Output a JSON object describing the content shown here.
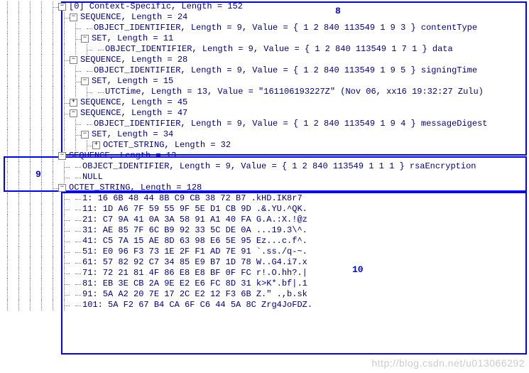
{
  "rows": [
    {
      "indent": 5,
      "expander": "−",
      "text": "[0] Context-Specific, Length = 152"
    },
    {
      "indent": 6,
      "expander": "−",
      "text": "SEQUENCE, Length = 24"
    },
    {
      "indent": 7,
      "expander": "",
      "text": "OBJECT_IDENTIFIER, Length = 9, Value = { 1 2 840 113549 1 9 3 } contentType"
    },
    {
      "indent": 7,
      "expander": "−",
      "text": "SET, Length = 11"
    },
    {
      "indent": 8,
      "expander": "",
      "text": "OBJECT_IDENTIFIER, Length = 9, Value = { 1 2 840 113549 1 7 1 } data"
    },
    {
      "indent": 6,
      "expander": "−",
      "text": "SEQUENCE, Length = 28"
    },
    {
      "indent": 7,
      "expander": "",
      "text": "OBJECT_IDENTIFIER, Length = 9, Value = { 1 2 840 113549 1 9 5 } signingTime"
    },
    {
      "indent": 7,
      "expander": "−",
      "text": "SET, Length = 15"
    },
    {
      "indent": 8,
      "expander": "",
      "text": "UTCTime, Length = 13, Value = \"161106193227Z\" (Nov 06, xx16 19:32:27 Zulu)"
    },
    {
      "indent": 6,
      "expander": "+",
      "text": "SEQUENCE, Length = 45"
    },
    {
      "indent": 6,
      "expander": "−",
      "text": "SEQUENCE, Length = 47"
    },
    {
      "indent": 7,
      "expander": "",
      "text": "OBJECT_IDENTIFIER, Length = 9, Value = { 1 2 840 113549 1 9 4 } messageDigest"
    },
    {
      "indent": 7,
      "expander": "−",
      "text": "SET, Length = 34"
    },
    {
      "indent": 8,
      "expander": "+",
      "text": "OCTET_STRING, Length = 32"
    },
    {
      "indent": 5,
      "expander": "−",
      "text": "SEQUENCE, Length = 13"
    },
    {
      "indent": 6,
      "expander": "",
      "text": "OBJECT_IDENTIFIER, Length = 9, Value = { 1 2 840 113549 1 1 1 } rsaEncryption"
    },
    {
      "indent": 6,
      "expander": "",
      "text": "NULL"
    },
    {
      "indent": 5,
      "expander": "−",
      "text": "OCTET_STRING, Length = 128"
    },
    {
      "indent": 6,
      "expander": "",
      "text": "  1: 16 6B 48 44 8B C9 CB 38 72 B7 .kHD.IK8r7"
    },
    {
      "indent": 6,
      "expander": "",
      "text": " 11: 1D A6 7F 59 55 9F 5E D1 CB 9D .&.YU.^QK."
    },
    {
      "indent": 6,
      "expander": "",
      "text": " 21: C7 9A 41 0A 3A 58 91 A1 40 FA G.A.:X.!@z"
    },
    {
      "indent": 6,
      "expander": "",
      "text": " 31: AE 85 7F 6C B9 92 33 5C DE 0A ...19.3\\^."
    },
    {
      "indent": 6,
      "expander": "",
      "text": " 41: C5 7A 15 AE 8D 63 98 E6 5E 95 Ez...c.f^."
    },
    {
      "indent": 6,
      "expander": "",
      "text": " 51: E0 96 F3 73 1E 2F F1 AD 7E 91 `.ss./q-~."
    },
    {
      "indent": 6,
      "expander": "",
      "text": " 61: 57 82 92 C7 34 85 E9 B7 1D 78 W..G4.i7.x"
    },
    {
      "indent": 6,
      "expander": "",
      "text": " 71: 72 21 81 4F 86 E8 E8 BF 0F FC r!.O.hh?.|"
    },
    {
      "indent": 6,
      "expander": "",
      "text": " 81: EB 3E CB 2A 9E E2 E6 FC 8D 31 k>K*.bf|.1"
    },
    {
      "indent": 6,
      "expander": "",
      "text": " 91: 5A A2 20 7E 17 2C E2 12 F3 6B Z.\" .,b.sk"
    },
    {
      "indent": 6,
      "expander": "",
      "text": "101: 5A F2 67 B4 CA 6F C6 44 5A 8C Zrg4JoFDZ."
    }
  ],
  "boxes": {
    "b8": {
      "label": "8"
    },
    "b9": {
      "label": "9"
    },
    "b10": {
      "label": "10"
    }
  },
  "watermark": "http://blog.csdn.net/u013066292"
}
